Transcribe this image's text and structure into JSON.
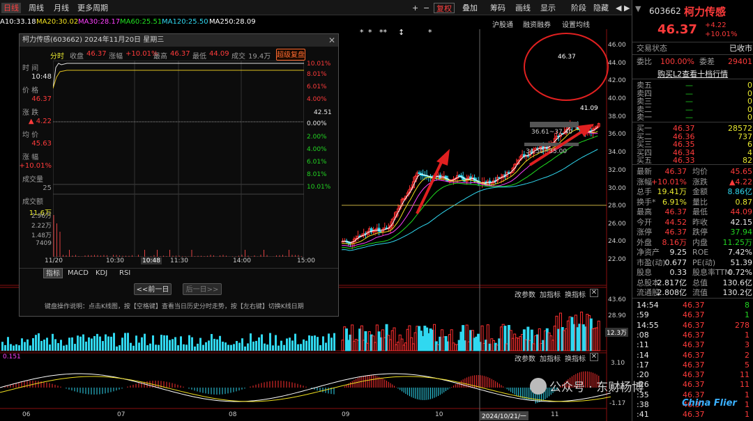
{
  "toolbar": {
    "left_tabs": [
      "日线",
      "周线",
      "月线",
      "更多周期"
    ],
    "right_buttons": [
      "复权",
      "叠加",
      "筹码",
      "画线",
      "显示",
      "阶段",
      "隐藏"
    ],
    "plus": "+",
    "minus": "−",
    "nav_arrows": "◀ ▶"
  },
  "ma_legend": [
    {
      "label": "A10:33.18",
      "color": "#ffffff"
    },
    {
      "label": "MA20:30.02",
      "color": "#f0e020"
    },
    {
      "label": "MA30:28.17",
      "color": "#ff40ff"
    },
    {
      "label": "MA60:25.51",
      "color": "#20e020"
    },
    {
      "label": "MA120:25.50",
      "color": "#30d8f0"
    },
    {
      "label": "MA250:28.09",
      "color": "#ffffff"
    }
  ],
  "chart_header": [
    "沪股通",
    "融资融券",
    "设置均线"
  ],
  "price_axis": [
    "46.00",
    "44.00",
    "42.00",
    "40.00",
    "38.00",
    "36.00",
    "34.00",
    "32.00",
    "30.00",
    "28.00",
    "26.00",
    "24.00",
    "22.00"
  ],
  "annotations": {
    "high_label": "46.37",
    "low_label": "41.09",
    "range1": "36.61~37.40",
    "range2": "34.50~35.00"
  },
  "volume_panel": {
    "buttons": [
      "改参数",
      "加指标",
      "换指标"
    ],
    "axis": [
      "43.60",
      "28.90",
      "12.3万"
    ]
  },
  "macd_panel": {
    "buttons": [
      "改参数",
      "加指标",
      "换指标"
    ],
    "axis": [
      "3.10",
      "0.00",
      "-1.17"
    ],
    "left_value": "0.151"
  },
  "date_axis": [
    "06",
    "07",
    "08",
    "09",
    "10",
    "2024/10/21/一",
    "11"
  ],
  "popup": {
    "title": "柯力传感(603662) 2024年11月20日 星期三",
    "info_label": "分时",
    "info": [
      {
        "k": "收盘",
        "v": "46.37",
        "c": "red"
      },
      {
        "k": "涨幅",
        "v": "+10.01%",
        "c": "red"
      },
      {
        "k": "最高",
        "v": "46.37",
        "c": "red"
      },
      {
        "k": "最低",
        "v": "44.09",
        "c": "red"
      },
      {
        "k": "成交",
        "v": "19.4万",
        "c": "gray"
      }
    ],
    "super_button": "超级复盘",
    "side": [
      {
        "k": "时 间",
        "v": "10:48",
        "vc": "wht"
      },
      {
        "k": "价 格",
        "v": "46.37",
        "vc": "red"
      },
      {
        "k": "涨 跌",
        "v": "▲ 4.22",
        "vc": "red"
      },
      {
        "k": "均 价",
        "v": "45.63",
        "vc": "red"
      },
      {
        "k": "涨 幅",
        "v": "+10.01%",
        "vc": "red"
      },
      {
        "k": "成交量",
        "v": "25",
        "vc": "gray"
      },
      {
        "k": "成交额",
        "v": "11.6万",
        "vc": "yel"
      }
    ],
    "right_axis": [
      {
        "v": "10.01%",
        "c": "red"
      },
      {
        "v": "8.01%",
        "c": "red"
      },
      {
        "v": "6.01%",
        "c": "red"
      },
      {
        "v": "4.00%",
        "c": "red"
      },
      {
        "v": "42.51",
        "c": "wht"
      },
      {
        "v": "0.00%",
        "c": "wht"
      },
      {
        "v": "2.00%",
        "c": "grn"
      },
      {
        "v": "4.00%",
        "c": "grn"
      },
      {
        "v": "6.01%",
        "c": "grn"
      },
      {
        "v": "8.01%",
        "c": "grn"
      },
      {
        "v": "10.01%",
        "c": "grn"
      }
    ],
    "vol_axis": [
      "2.96万",
      "2.22万",
      "1.48万",
      "7409"
    ],
    "time_axis": [
      "11/20",
      "10:30",
      "10:48",
      "11:30",
      "14:00",
      "15:00"
    ],
    "tabs": [
      "指标",
      "MACD",
      "KDJ",
      "RSI"
    ],
    "prev_day": "<<前一日",
    "next_day": "后一日>>",
    "hint": "键盘操作说明：点击K线图，按【空格键】查看当日历史分时走势，按【左右键】切换K线日期"
  },
  "quote": {
    "code": "603662",
    "name": "柯力传感",
    "price": "46.37",
    "change": "+4.22",
    "change_pct": "+10.01%",
    "status_label": "交易状态",
    "status": "已收市",
    "ratio_label": "委比",
    "ratio": "100.00%",
    "diff_label": "委差",
    "diff": "29401",
    "l2_link": "购买L2查看十档行情",
    "asks": [
      {
        "k": "卖五",
        "p": "—",
        "v": "0"
      },
      {
        "k": "卖四",
        "p": "—",
        "v": "0"
      },
      {
        "k": "卖三",
        "p": "—",
        "v": "0"
      },
      {
        "k": "卖二",
        "p": "—",
        "v": "0"
      },
      {
        "k": "卖一",
        "p": "—",
        "v": "0"
      }
    ],
    "bids": [
      {
        "k": "买一",
        "p": "46.37",
        "v": "28572"
      },
      {
        "k": "买二",
        "p": "46.36",
        "v": "737"
      },
      {
        "k": "买三",
        "p": "46.35",
        "v": "6"
      },
      {
        "k": "买四",
        "p": "46.34",
        "v": "4"
      },
      {
        "k": "买五",
        "p": "46.33",
        "v": "82"
      }
    ],
    "stats": [
      [
        {
          "k": "最新",
          "v": "46.37",
          "c": "red"
        },
        {
          "k": "均价",
          "v": "45.65",
          "c": "red"
        }
      ],
      [
        {
          "k": "涨幅",
          "v": "+10.01%",
          "c": "red"
        },
        {
          "k": "涨跌",
          "v": "▲4.22",
          "c": "red"
        }
      ],
      [
        {
          "k": "总手",
          "v": "19.41万",
          "c": "yel"
        },
        {
          "k": "金额",
          "v": "8.86亿",
          "c": "cyan"
        }
      ],
      [
        {
          "k": "换手*",
          "v": "6.91%",
          "c": "yel"
        },
        {
          "k": "量比",
          "v": "0.87",
          "c": "yel"
        }
      ],
      [
        {
          "k": "最高",
          "v": "46.37",
          "c": "red"
        },
        {
          "k": "最低",
          "v": "44.09",
          "c": "red"
        }
      ],
      [
        {
          "k": "今开",
          "v": "44.52",
          "c": "red"
        },
        {
          "k": "昨收",
          "v": "42.15",
          "c": "wht"
        }
      ],
      [
        {
          "k": "涨停",
          "v": "46.37",
          "c": "red"
        },
        {
          "k": "跌停",
          "v": "37.94",
          "c": "grn"
        }
      ],
      [
        {
          "k": "外盘",
          "v": "8.16万",
          "c": "red"
        },
        {
          "k": "内盘",
          "v": "11.25万",
          "c": "grn"
        }
      ],
      [
        {
          "k": "净资产",
          "v": "9.25",
          "c": "wht"
        },
        {
          "k": "ROE",
          "v": "7.42%",
          "c": "wht"
        }
      ],
      [
        {
          "k": "市盈(动)",
          "v": "0.677",
          "c": "wht"
        },
        {
          "k": "PE(动)",
          "v": "51.39",
          "c": "wht"
        }
      ],
      [
        {
          "k": "股息",
          "v": "0.33",
          "c": "wht"
        },
        {
          "k": "股息率TTM",
          "v": "0.72%",
          "c": "wht"
        }
      ],
      [
        {
          "k": "总股本",
          "v": "2.817亿",
          "c": "wht"
        },
        {
          "k": "总值",
          "v": "130.6亿",
          "c": "wht"
        }
      ],
      [
        {
          "k": "流通股",
          "v": "2.808亿",
          "c": "wht"
        },
        {
          "k": "流值",
          "v": "130.2亿",
          "c": "wht"
        }
      ]
    ],
    "ticks": [
      {
        "t": "14:54",
        "p": "46.37",
        "v": "8",
        "vc": "grn"
      },
      {
        "t": ":59",
        "p": "46.37",
        "v": "1",
        "vc": "grn"
      },
      {
        "t": "14:55",
        "p": "46.37",
        "v": "278",
        "vc": "red"
      },
      {
        "t": ":08",
        "p": "46.37",
        "v": "1",
        "vc": "red"
      },
      {
        "t": ":11",
        "p": "46.37",
        "v": "3",
        "vc": "red"
      },
      {
        "t": ":14",
        "p": "46.37",
        "v": "2",
        "vc": "red"
      },
      {
        "t": ":17",
        "p": "46.37",
        "v": "5",
        "vc": "red"
      },
      {
        "t": ":20",
        "p": "46.37",
        "v": "11",
        "vc": "red"
      },
      {
        "t": ":26",
        "p": "46.37",
        "v": "11",
        "vc": "red"
      },
      {
        "t": ":35",
        "p": "46.37",
        "v": "1",
        "vc": "red"
      },
      {
        "t": ":38",
        "p": "46.37",
        "v": "1",
        "vc": "red"
      },
      {
        "t": ":41",
        "p": "46.37",
        "v": "1",
        "vc": "red"
      }
    ]
  },
  "watermark": {
    "text": "公众号 · 东财杨博",
    "logo": "China Flier"
  }
}
